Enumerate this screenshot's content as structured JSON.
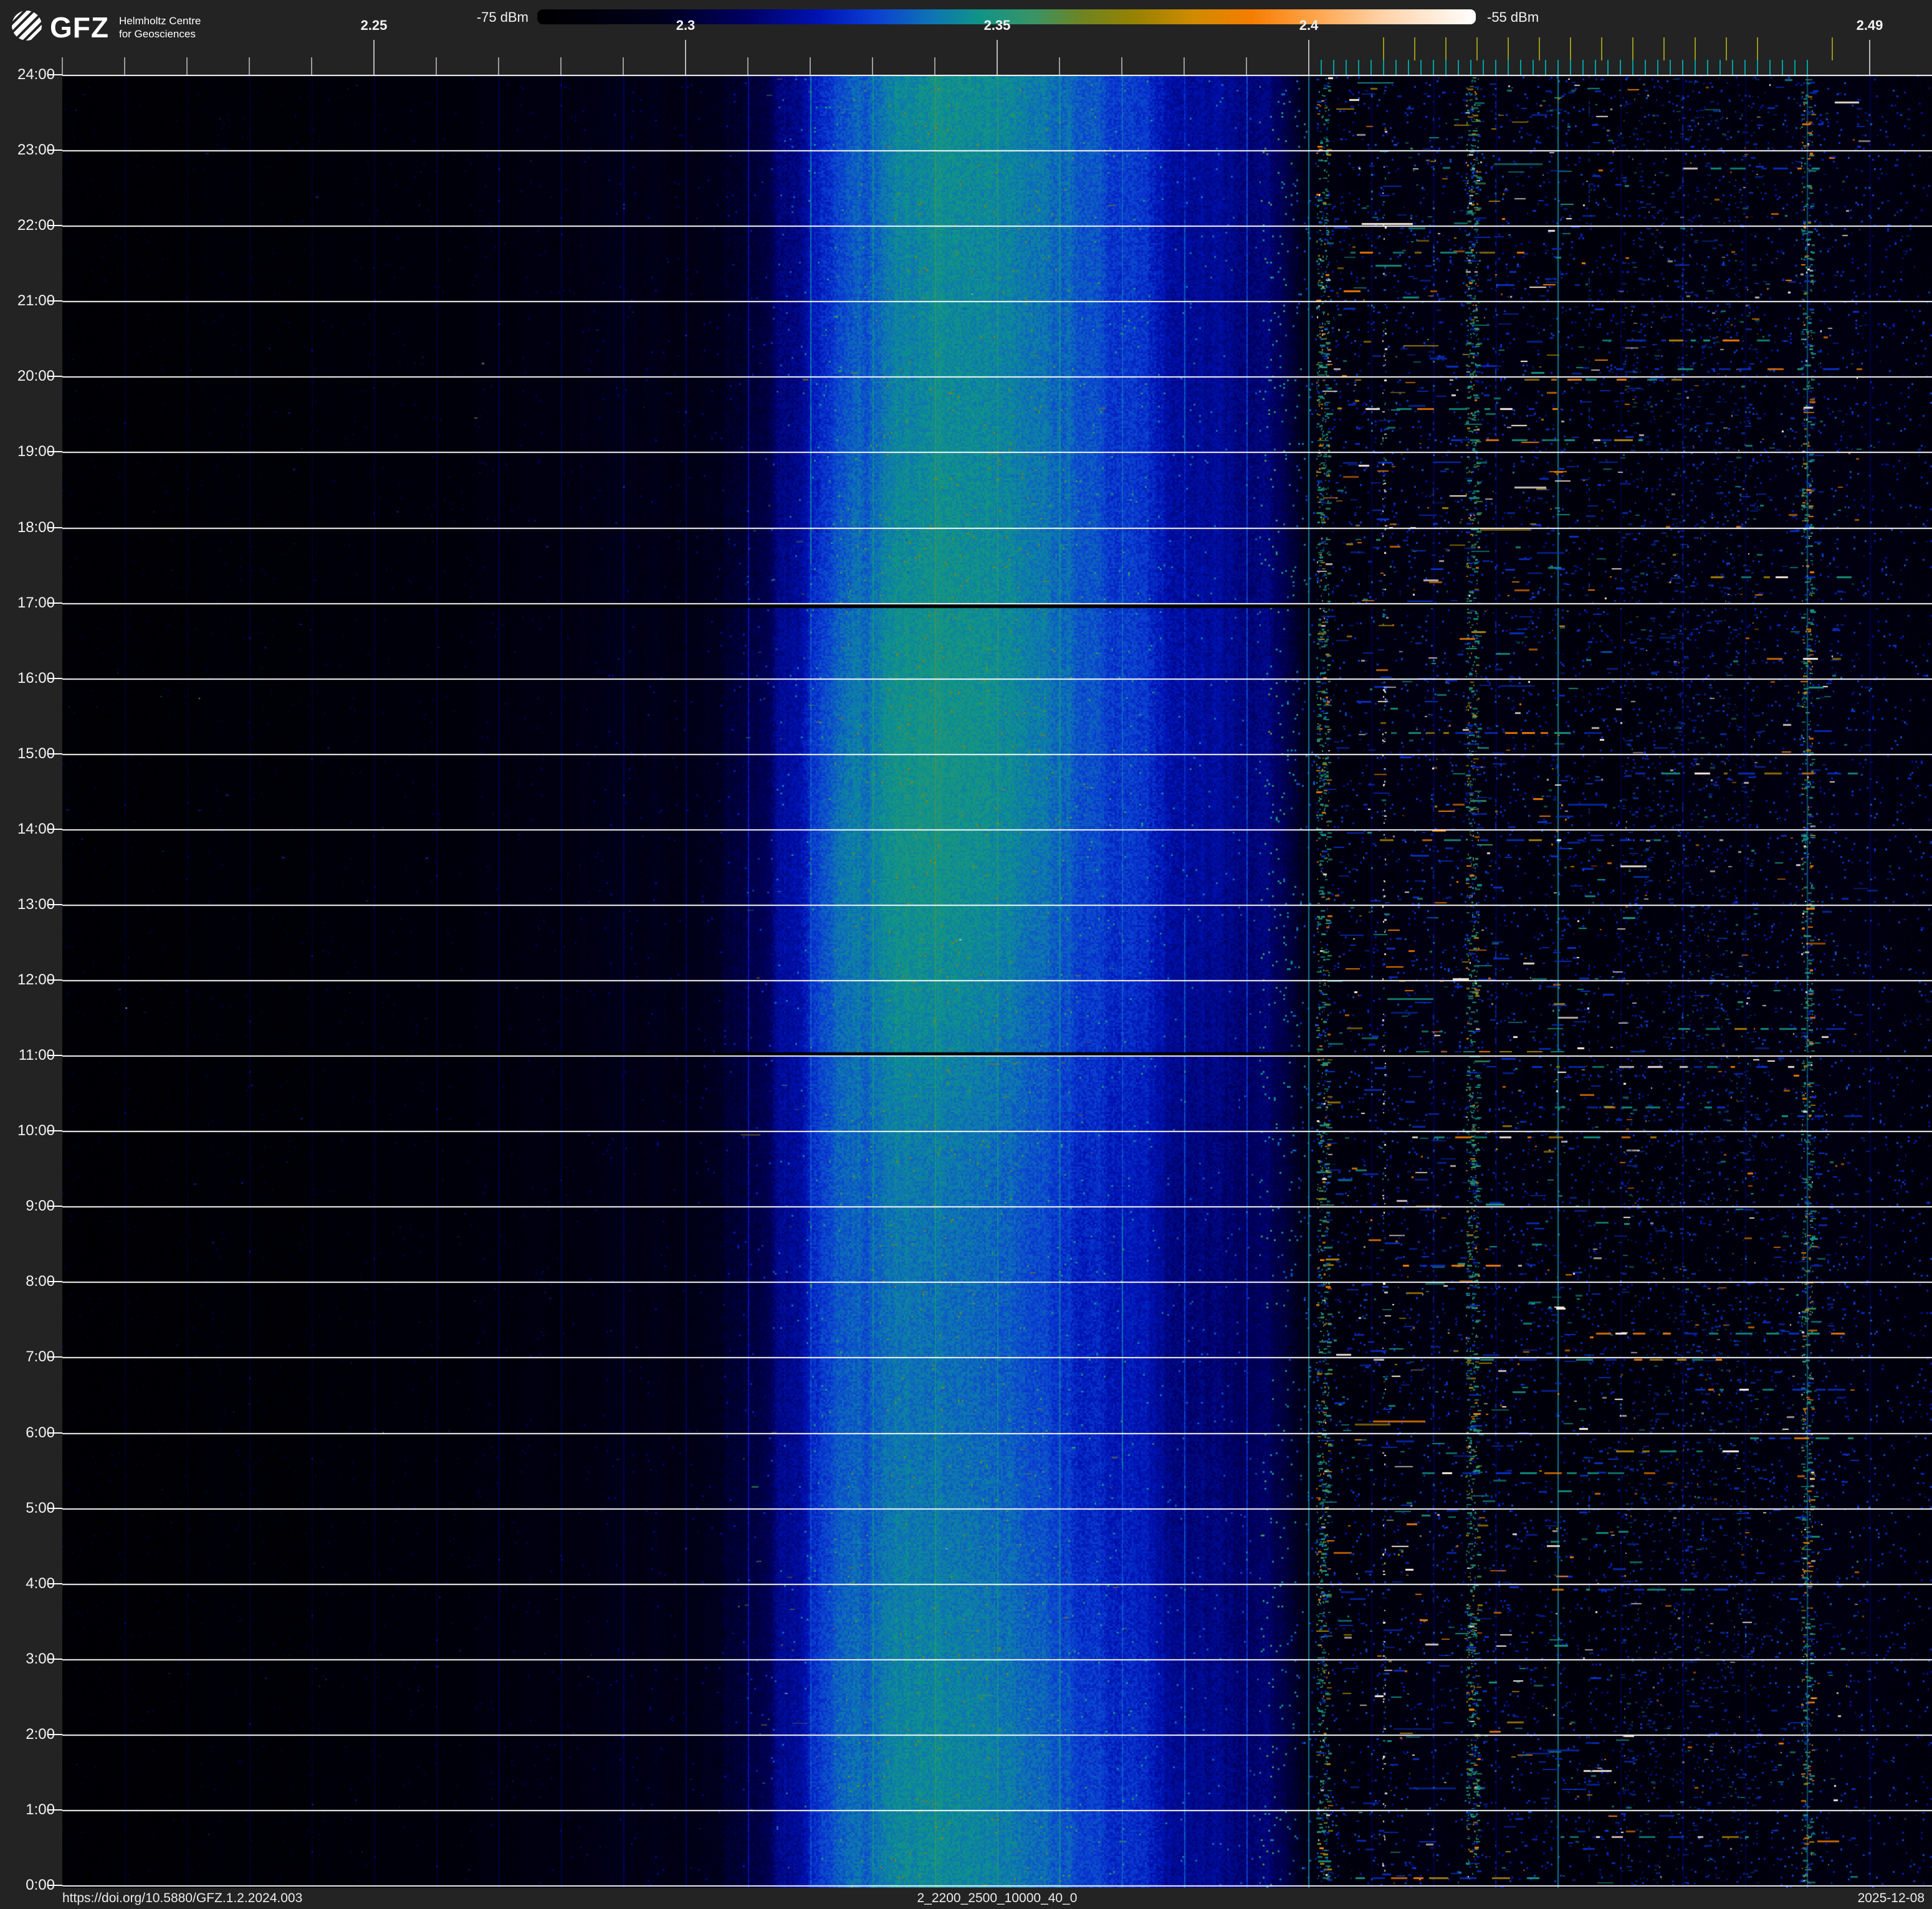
{
  "page_background": "#232323",
  "header": {
    "logo_text": "GFZ",
    "org_line1": "Helmholtz Centre",
    "org_line2": "for Geosciences"
  },
  "colorbar": {
    "min_label": "-75 dBm",
    "max_label": "-55 dBm",
    "gradient_stops": [
      [
        0,
        "#000000"
      ],
      [
        0.13,
        "#00001c"
      ],
      [
        0.22,
        "#000060"
      ],
      [
        0.3,
        "#0013b4"
      ],
      [
        0.36,
        "#0b3fd2"
      ],
      [
        0.42,
        "#0e74b4"
      ],
      [
        0.47,
        "#0f9488"
      ],
      [
        0.53,
        "#3a9464"
      ],
      [
        0.58,
        "#6e8422"
      ],
      [
        0.64,
        "#9a8200"
      ],
      [
        0.7,
        "#d08b00"
      ],
      [
        0.76,
        "#f57d00"
      ],
      [
        0.83,
        "#ffa54d"
      ],
      [
        0.9,
        "#ffd2a8"
      ],
      [
        1,
        "#ffffff"
      ]
    ]
  },
  "footer": {
    "doi": "https://doi.org/10.5880/GFZ.1.2.2024.003",
    "filename": "2_2200_2500_10000_40_0",
    "date": "2025-12-08"
  },
  "chart_data": {
    "type": "heatmap",
    "subtype": "spectrogram-waterfall",
    "title": "2_2200_2500_10000_40_0",
    "power_scale": {
      "min_label": "-75 dBm",
      "max_label": "-55 dBm"
    },
    "x_axis": {
      "unit": "GHz",
      "range_mhz": [
        2200,
        2500
      ],
      "labeled_ticks": [
        {
          "mhz": 2250,
          "label": "2.25"
        },
        {
          "mhz": 2300,
          "label": "2.3"
        },
        {
          "mhz": 2350,
          "label": "2.35"
        },
        {
          "mhz": 2400,
          "label": "2.4"
        },
        {
          "mhz": 2490,
          "label": "2.49"
        }
      ],
      "minor_tick_step_mhz": 10,
      "minor_tick_range_mhz": [
        2200,
        2400
      ],
      "wifi_channel_ticks_mhz": [
        2412,
        2417,
        2422,
        2427,
        2432,
        2437,
        2442,
        2447,
        2452,
        2457,
        2462,
        2467,
        2472,
        2484
      ],
      "ble_channel_ticks_mhz": {
        "start": 2402,
        "end": 2480,
        "step": 2
      },
      "tick_color": "#9c9c9c",
      "labeled_tick_color": "#b8b8b8",
      "wifi_tick_color": "#97971e",
      "ble_tick_color": "#00a0a2",
      "label_color": "#f2f2f2"
    },
    "y_axis": {
      "unit": "time of day",
      "direction": "24:00 at top, 0:00 at bottom",
      "tick_labels": [
        "24:00",
        "23:00",
        "22:00",
        "21:00",
        "20:00",
        "19:00",
        "18:00",
        "17:00",
        "16:00",
        "15:00",
        "14:00",
        "13:00",
        "12:00",
        "11:00",
        "10:00",
        "9:00",
        "8:00",
        "7:00",
        "6:00",
        "5:00",
        "4:00",
        "3:00",
        "2:00",
        "1:00",
        "0:00"
      ],
      "hour_line_color": "#fafafa"
    },
    "broadband_profile_mhz_level": [
      [
        2200,
        0.03
      ],
      [
        2230,
        0.035
      ],
      [
        2252,
        0.05
      ],
      [
        2280,
        0.072
      ],
      [
        2295,
        0.1
      ],
      [
        2305,
        0.15
      ],
      [
        2313,
        0.22
      ],
      [
        2320,
        0.3
      ],
      [
        2326,
        0.39
      ],
      [
        2332,
        0.445
      ],
      [
        2338,
        0.475
      ],
      [
        2347,
        0.465
      ],
      [
        2354,
        0.44
      ],
      [
        2360,
        0.405
      ],
      [
        2366,
        0.345
      ],
      [
        2374,
        0.302
      ],
      [
        2385,
        0.278
      ],
      [
        2394,
        0.24
      ],
      [
        2398,
        0.175
      ],
      [
        2400,
        0.12
      ],
      [
        2402,
        0.08
      ],
      [
        2410,
        0.07
      ],
      [
        2430,
        0.068
      ],
      [
        2450,
        0.062
      ],
      [
        2465,
        0.072
      ],
      [
        2480,
        0.068
      ],
      [
        2492,
        0.078
      ],
      [
        2500,
        0.068
      ]
    ],
    "persistent_lines": [
      {
        "mhz": 2360,
        "alpha": 0.35
      },
      {
        "mhz": 2400,
        "alpha": 0.8
      },
      {
        "mhz": 2440,
        "alpha": 0.8
      },
      {
        "mhz": 2480,
        "alpha": 0.5
      }
    ],
    "dotted_columns": [
      {
        "mhz": 2420,
        "n": 130
      },
      {
        "mhz": 2430,
        "n": 150
      },
      {
        "mhz": 2445,
        "n": 120
      },
      {
        "mhz": 2460,
        "n": 110
      }
    ],
    "gap_rows": [
      {
        "near_label": "17:00",
        "side": "below"
      },
      {
        "near_label": "11:00",
        "side": "above"
      }
    ],
    "activity_clusters": [
      {
        "name": "ble-ch37",
        "mhz": [
          2401.2,
          2403.2
        ],
        "n": 1500,
        "len": [
          2,
          9
        ],
        "alpha": [
          0.6,
          1
        ],
        "palette": [
          [
            0.48,
            45
          ],
          [
            0.53,
            22
          ],
          [
            0.34,
            15
          ],
          [
            0.66,
            8
          ],
          [
            0.76,
            7
          ],
          [
            0.97,
            3
          ]
        ]
      },
      {
        "name": "ble-ch38",
        "mhz": [
          2425.2,
          2427.2
        ],
        "n": 1500,
        "len": [
          2,
          9
        ],
        "alpha": [
          0.6,
          1
        ],
        "palette": [
          [
            0.48,
            45
          ],
          [
            0.53,
            22
          ],
          [
            0.34,
            15
          ],
          [
            0.66,
            8
          ],
          [
            0.76,
            7
          ],
          [
            0.97,
            3
          ]
        ]
      },
      {
        "name": "ble-ch39",
        "mhz": [
          2479.0,
          2480.8
        ],
        "n": 1150,
        "len": [
          2,
          9
        ],
        "alpha": [
          0.6,
          1
        ],
        "palette": [
          [
            0.48,
            42
          ],
          [
            0.53,
            20
          ],
          [
            0.34,
            15
          ],
          [
            0.66,
            8
          ],
          [
            0.76,
            11
          ],
          [
            0.97,
            4
          ]
        ]
      },
      {
        "name": "wifi-ch1-beacon",
        "mhz": [
          2411.8,
          2412.3
        ],
        "n": 240,
        "len": [
          2,
          5
        ],
        "alpha": [
          0.7,
          1
        ],
        "palette": [
          [
            0.97,
            55
          ],
          [
            0.48,
            20
          ],
          [
            0.38,
            25
          ]
        ]
      },
      {
        "name": "wifi-low-activity",
        "mhz": [
          2404,
          2440
        ],
        "n": 950,
        "len": [
          3,
          30
        ],
        "alpha": [
          0.55,
          1
        ],
        "palette": [
          [
            0.34,
            52
          ],
          [
            0.48,
            20
          ],
          [
            0.76,
            12
          ],
          [
            0.97,
            8
          ],
          [
            0.66,
            8
          ]
        ]
      },
      {
        "name": "wifi-mid-activity",
        "mhz": [
          2438,
          2452
        ],
        "n": 400,
        "len": [
          3,
          22
        ],
        "alpha": [
          0.55,
          1
        ],
        "palette": [
          [
            0.34,
            58
          ],
          [
            0.48,
            20
          ],
          [
            0.97,
            11
          ],
          [
            0.76,
            11
          ]
        ]
      },
      {
        "name": "wifi-mid-cloud",
        "mhz": [
          2450,
          2472
        ],
        "n": 2200,
        "len": [
          2,
          9
        ],
        "alpha": [
          0.35,
          0.7
        ],
        "palette": [
          [
            0.36,
            80
          ],
          [
            0.48,
            12
          ],
          [
            0.97,
            4
          ],
          [
            0.76,
            4
          ]
        ]
      },
      {
        "name": "wifi-upper-activity",
        "mhz": [
          2468,
          2488
        ],
        "n": 450,
        "len": [
          2,
          16
        ],
        "alpha": [
          0.55,
          1
        ],
        "palette": [
          [
            0.34,
            55
          ],
          [
            0.48,
            20
          ],
          [
            0.97,
            12
          ],
          [
            0.76,
            13
          ]
        ]
      },
      {
        "name": "sprinkle",
        "mhz": [
          2403,
          2490
        ],
        "n": 1700,
        "len": [
          2,
          8
        ],
        "alpha": [
          0.3,
          0.65
        ],
        "palette": [
          [
            0.35,
            85
          ],
          [
            0.48,
            8
          ],
          [
            0.97,
            4
          ],
          [
            0.76,
            3
          ]
        ]
      },
      {
        "name": "right-edge",
        "mhz": [
          2488,
          2500
        ],
        "n": 170,
        "len": [
          2,
          6
        ],
        "alpha": [
          0.3,
          0.6
        ],
        "palette": [
          [
            0.35,
            90
          ],
          [
            0.48,
            10
          ]
        ]
      },
      {
        "name": "left-sparse",
        "mhz": [
          2200,
          2396
        ],
        "n": 280,
        "len": [
          2,
          6
        ],
        "alpha": [
          0.25,
          0.55
        ],
        "palette": [
          [
            0.35,
            88
          ],
          [
            0.48,
            7
          ],
          [
            0.97,
            5
          ]
        ]
      },
      {
        "name": "band-flecks",
        "mhz": [
          2308,
          2372
        ],
        "n": 200,
        "len": [
          3,
          12
        ],
        "alpha": [
          0.3,
          0.6
        ],
        "palette": [
          [
            0.62,
            55
          ],
          [
            0.53,
            45
          ]
        ]
      }
    ],
    "burst_rows": {
      "count": 28,
      "mhz_span": [
        2404,
        2488
      ],
      "dashes_per_row": [
        6,
        14
      ]
    },
    "render_seed": 1337
  }
}
